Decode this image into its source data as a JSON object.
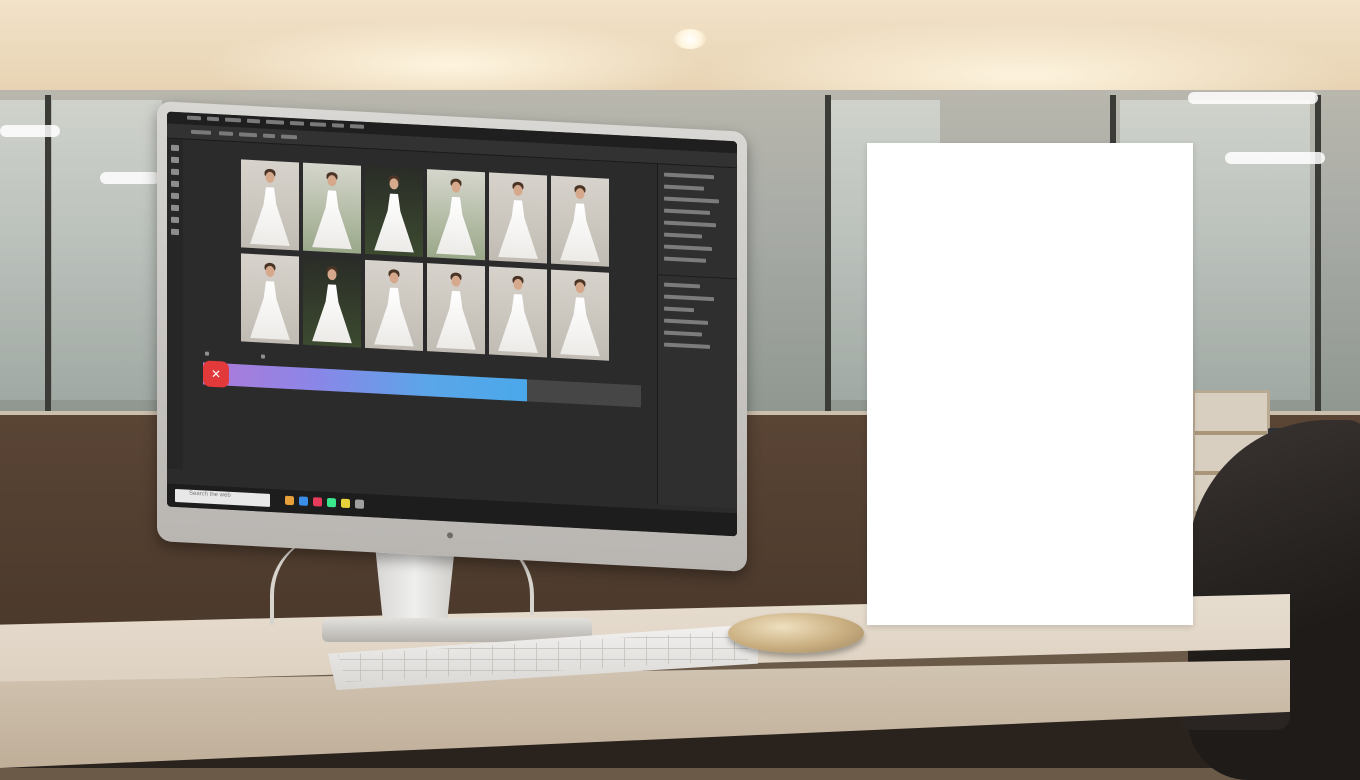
{
  "scene": {
    "description_tag": "office-desk-monitor",
    "poster_color": "#ffffff",
    "accent_colors": {
      "progress_start": "#b07ad8",
      "progress_end": "#4aa8ea",
      "app_badge": "#e23a3a"
    }
  },
  "monitor": {
    "app": {
      "gallery": {
        "thumbnails": [
          {
            "style": "light"
          },
          {
            "style": "green"
          },
          {
            "style": "dark"
          },
          {
            "style": "green"
          },
          {
            "style": "light"
          },
          {
            "style": "light"
          },
          {
            "style": "light"
          },
          {
            "style": "dark"
          },
          {
            "style": "light"
          },
          {
            "style": "light"
          },
          {
            "style": "light"
          },
          {
            "style": "light"
          }
        ]
      },
      "progress": {
        "value": 0.74
      },
      "taskbar": {
        "search_placeholder": "Search the web",
        "icons": [
          "#e8a13a",
          "#3a8de8",
          "#e83a5a",
          "#3ae88d",
          "#e8d43a",
          "#a0a0a0"
        ]
      }
    }
  }
}
